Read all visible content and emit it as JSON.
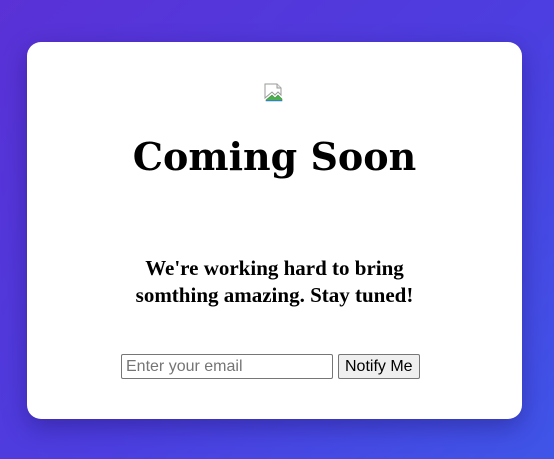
{
  "hero": {
    "image_icon": "broken-image-icon",
    "title": "Coming Soon",
    "tagline": "We're working hard to bring somthing amazing. Stay tuned!"
  },
  "signup": {
    "email_placeholder": "Enter your email",
    "email_value": "",
    "button_label": "Notify Me"
  },
  "colors": {
    "background_start": "#5a31d6",
    "background_end": "#3f55e8",
    "card": "#ffffff"
  }
}
